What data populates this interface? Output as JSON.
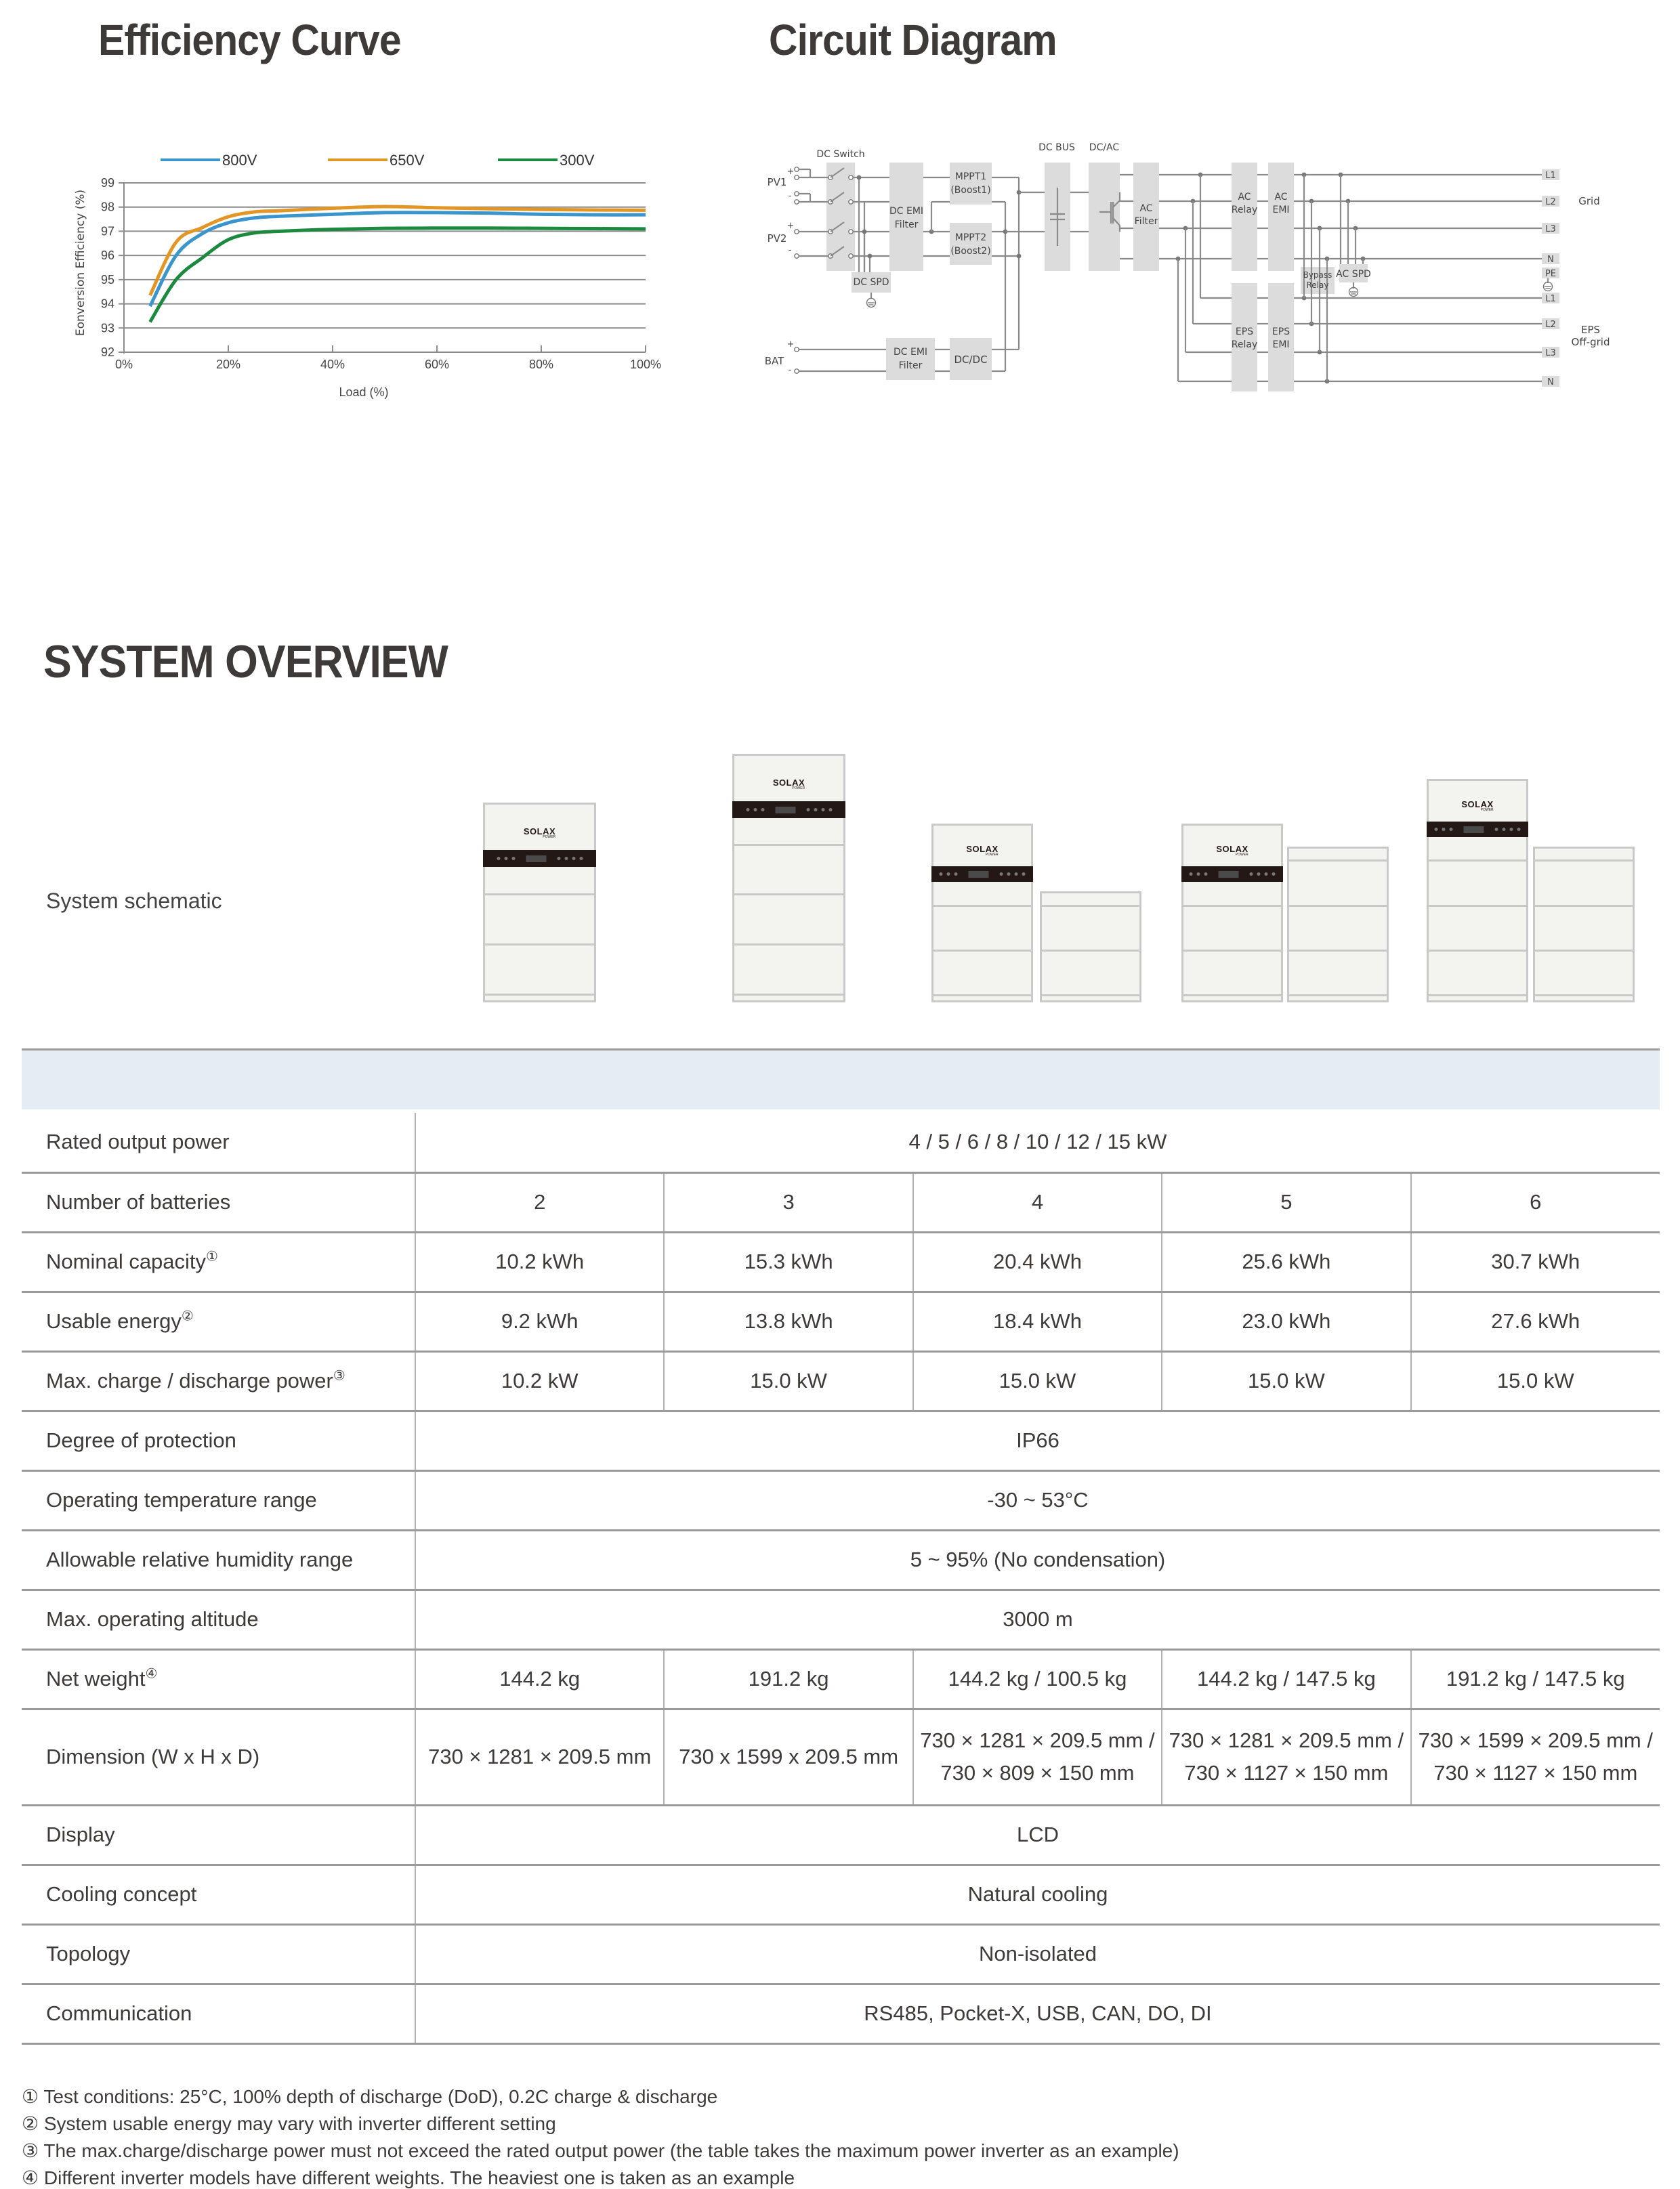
{
  "sections": {
    "efficiency_title": "Efficiency Curve",
    "circuit_title": "Circuit Diagram",
    "system_title": "SYSTEM OVERVIEW"
  },
  "chart_data": {
    "type": "line",
    "title": "Efficiency Curve",
    "xlabel": "Load (%)",
    "ylabel": "Eonversion Efficiency (%)",
    "xlim": [
      0,
      100
    ],
    "ylim": [
      92,
      99
    ],
    "x_ticks": [
      "0%",
      "20%",
      "40%",
      "60%",
      "80%",
      "100%"
    ],
    "y_ticks": [
      "92",
      "93",
      "94",
      "95",
      "96",
      "97",
      "98",
      "99"
    ],
    "grid": true,
    "legend_position": "top",
    "x": [
      5,
      10,
      15,
      20,
      25,
      30,
      40,
      50,
      60,
      70,
      80,
      90,
      100
    ],
    "series": [
      {
        "name": "800V",
        "color": "#3a95cc",
        "values": [
          93.9,
          96.0,
          96.9,
          97.35,
          97.55,
          97.62,
          97.7,
          97.77,
          97.77,
          97.75,
          97.7,
          97.68,
          97.68
        ]
      },
      {
        "name": "650V",
        "color": "#e29625",
        "values": [
          94.35,
          96.55,
          97.15,
          97.6,
          97.8,
          97.85,
          97.95,
          98.02,
          97.97,
          97.93,
          97.9,
          97.88,
          97.87
        ]
      },
      {
        "name": "300V",
        "color": "#1c8a3e",
        "values": [
          93.25,
          95.0,
          95.9,
          96.65,
          96.93,
          97.0,
          97.08,
          97.12,
          97.13,
          97.13,
          97.12,
          97.11,
          97.1
        ]
      }
    ]
  },
  "circuit": {
    "labels": {
      "dc_switch": "DC Switch",
      "pv1": "PV1",
      "pv2": "PV2",
      "bat": "BAT",
      "plus": "+",
      "minus": "-",
      "dc_emi_filter": [
        "DC EMI",
        "Filter"
      ],
      "mppt1": [
        "MPPT1",
        "(Boost1)"
      ],
      "mppt2": [
        "MPPT2",
        "(Boost2)"
      ],
      "dc_spd": "DC SPD",
      "bat_dc_emi_filter": [
        "DC EMI",
        "Filter"
      ],
      "dcdc": "DC/DC",
      "dc_bus": "DC BUS",
      "dc_ac": "DC/AC",
      "ac_filter": [
        "AC",
        "Filter"
      ],
      "ac_relay": [
        "AC",
        "Relay"
      ],
      "ac_emi": [
        "AC",
        "EMI"
      ],
      "eps_relay": [
        "EPS",
        "Relay"
      ],
      "eps_emi": [
        "EPS",
        "EMI"
      ],
      "bypass_relay": [
        "Bypass",
        "Relay"
      ],
      "ac_spd": "AC SPD",
      "grid": "Grid",
      "eps_offgrid": [
        "EPS",
        "Off-grid"
      ]
    },
    "grid_terminals": [
      "L1",
      "L2",
      "L3",
      "N",
      "PE"
    ],
    "eps_terminals": [
      "L1",
      "L2",
      "L3",
      "N"
    ]
  },
  "schematic": {
    "label": "System schematic",
    "brand": "SOLAX",
    "brand_sub": "POWER"
  },
  "table": {
    "rows": [
      {
        "label": "Rated output power",
        "sup": "",
        "span": true,
        "value": "4 / 5 / 6 / 8 / 10 / 12 / 15 kW"
      },
      {
        "label": "Number of batteries",
        "sup": "",
        "span": false,
        "values": [
          "2",
          "3",
          "4",
          "5",
          "6"
        ]
      },
      {
        "label": "Nominal capacity",
        "sup": "①",
        "span": false,
        "values": [
          "10.2 kWh",
          "15.3 kWh",
          "20.4 kWh",
          "25.6 kWh",
          "30.7 kWh"
        ]
      },
      {
        "label": "Usable energy",
        "sup": "②",
        "span": false,
        "values": [
          "9.2 kWh",
          "13.8 kWh",
          "18.4 kWh",
          "23.0 kWh",
          "27.6 kWh"
        ]
      },
      {
        "label": "Max. charge / discharge power",
        "sup": "③",
        "span": false,
        "values": [
          "10.2 kW",
          "15.0 kW",
          "15.0 kW",
          "15.0 kW",
          "15.0 kW"
        ]
      },
      {
        "label": "Degree of protection",
        "sup": "",
        "span": true,
        "value": "IP66"
      },
      {
        "label": "Operating temperature range",
        "sup": "",
        "span": true,
        "value": "-30 ~ 53°C"
      },
      {
        "label": "Allowable relative humidity range",
        "sup": "",
        "span": true,
        "value": "5 ~ 95% (No condensation)"
      },
      {
        "label": "Max. operating altitude",
        "sup": "",
        "span": true,
        "value": "3000 m"
      },
      {
        "label": "Net weight",
        "sup": "④",
        "span": false,
        "values": [
          "144.2 kg",
          "191.2 kg",
          "144.2 kg / 100.5 kg",
          "144.2 kg / 147.5 kg",
          "191.2 kg / 147.5 kg"
        ]
      },
      {
        "label": "Dimension (W x H x D)",
        "sup": "",
        "span": false,
        "tall": true,
        "values": [
          "730 × 1281 × 209.5 mm",
          "730 x 1599 x 209.5 mm",
          "730 × 1281 × 209.5 mm / 730 × 809 × 150 mm",
          "730 × 1281 × 209.5 mm / 730 × 1127 × 150 mm",
          "730 × 1599 × 209.5 mm / 730 × 1127 × 150 mm"
        ]
      },
      {
        "label": "Display",
        "sup": "",
        "span": true,
        "value": "LCD"
      },
      {
        "label": "Cooling concept",
        "sup": "",
        "span": true,
        "value": "Natural cooling"
      },
      {
        "label": "Topology",
        "sup": "",
        "span": true,
        "value": "Non-isolated"
      },
      {
        "label": "Communication",
        "sup": "",
        "span": true,
        "value": "RS485, Pocket-X, USB, CAN, DO, DI"
      }
    ]
  },
  "footnotes": [
    "① Test conditions: 25°C, 100% depth of discharge (DoD), 0.2C charge & discharge",
    "② System usable energy may vary with inverter different setting",
    "③ The max.charge/discharge power must not exceed the rated output power (the table takes the maximum power inverter as an example)",
    "④ Different inverter models have different weights. The heaviest one is taken as an example"
  ]
}
